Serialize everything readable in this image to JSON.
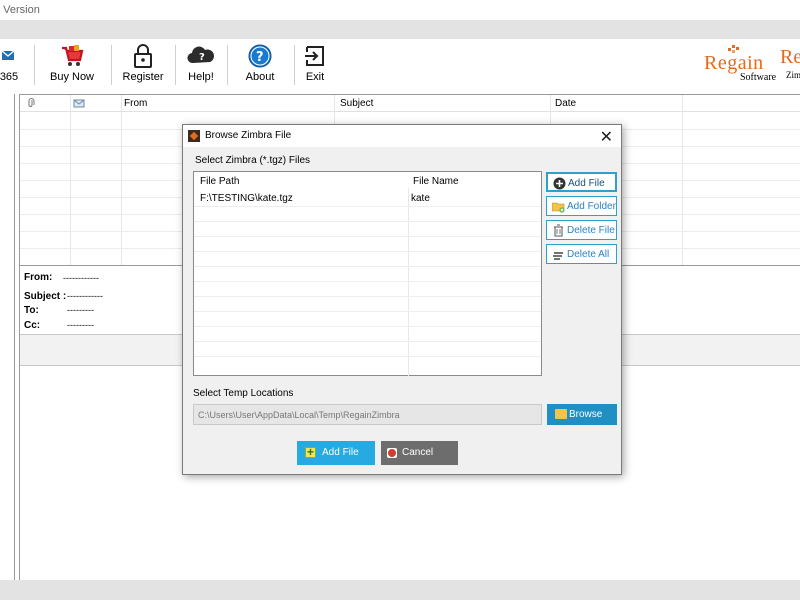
{
  "window": {
    "title_fragment": "o Version"
  },
  "toolbar": {
    "items": [
      {
        "label": "365",
        "icon": "mail-icon"
      },
      {
        "label": "Buy Now",
        "icon": "shopping-cart-icon"
      },
      {
        "label": "Register",
        "icon": "lock-icon"
      },
      {
        "label": "Help!",
        "icon": "help-cloud-icon"
      },
      {
        "label": "About",
        "icon": "info-question-icon"
      },
      {
        "label": "Exit",
        "icon": "exit-icon"
      }
    ]
  },
  "logo": {
    "brand": "Regain",
    "sub": "Software",
    "brand2": "Re",
    "sub2": "Zim"
  },
  "grid": {
    "columns": [
      "From",
      "Subject",
      "Date"
    ]
  },
  "preview": {
    "from_label": "From:",
    "from_value": "------------",
    "subject_label": "Subject :",
    "subject_value": "------------",
    "to_label": "To:",
    "to_value": "---------",
    "cc_label": "Cc:",
    "cc_value": "---------"
  },
  "dialog": {
    "title": "Browse Zimbra File",
    "select_label": "Select Zimbra (*.tgz) Files",
    "columns": [
      "File Path",
      "File Name"
    ],
    "rows": [
      {
        "path": "F:\\TESTING\\kate.tgz",
        "name": "kate"
      }
    ],
    "side_buttons": {
      "add_file": "Add File",
      "add_folder": "Add Folder",
      "delete_file": "Delete File",
      "delete_all": "Delete All"
    },
    "temp_label": "Select Temp Locations",
    "temp_value": "C:\\Users\\User\\AppData\\Local\\Temp\\RegainZimbra",
    "browse_label": "Browse",
    "add_file_label": "Add File",
    "cancel_label": "Cancel"
  },
  "colors": {
    "accent": "#27a9e1",
    "brand": "#e46a1d",
    "cancel": "#6d6d6d"
  }
}
